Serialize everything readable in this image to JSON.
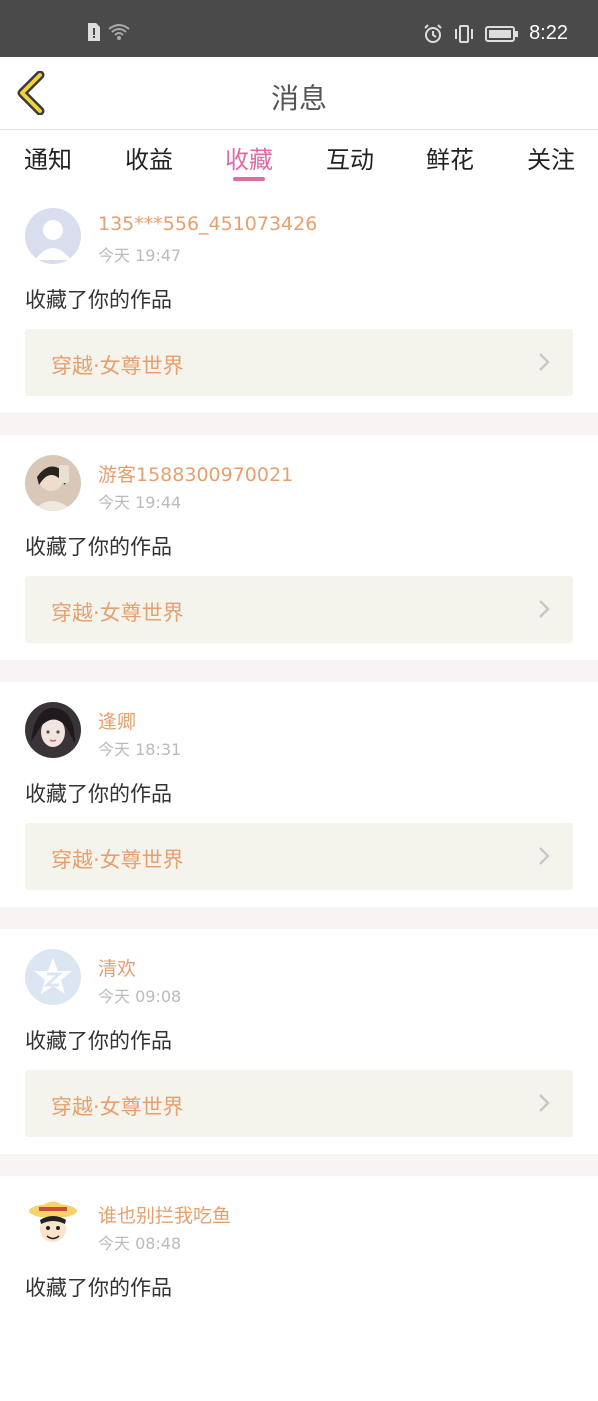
{
  "status_bar": {
    "time": "8:22"
  },
  "header": {
    "title": "消息"
  },
  "tabs": [
    {
      "label": "通知"
    },
    {
      "label": "收益"
    },
    {
      "label": "收藏",
      "active": true
    },
    {
      "label": "互动"
    },
    {
      "label": "鲜花"
    },
    {
      "label": "关注"
    }
  ],
  "messages": [
    {
      "user": "135***556_451073426",
      "time": "今天 19:47",
      "action": "收藏了你的作品",
      "work": "穿越·女尊世界",
      "avatar": "default-avatar-icon"
    },
    {
      "user": "游客1588300970021",
      "time": "今天 19:44",
      "action": "收藏了你的作品",
      "work": "穿越·女尊世界",
      "avatar": "photo-avatar"
    },
    {
      "user": "逢卿",
      "time": "今天 18:31",
      "action": "收藏了你的作品",
      "work": "穿越·女尊世界",
      "avatar": "illustrated-avatar"
    },
    {
      "user": "清欢",
      "time": "今天 09:08",
      "action": "收藏了你的作品",
      "work": "穿越·女尊世界",
      "avatar": "star-z-avatar-icon"
    },
    {
      "user": "谁也别拦我吃鱼",
      "time": "今天 08:48",
      "action": "收藏了你的作品",
      "work": "",
      "avatar": "cartoon-avatar"
    }
  ],
  "colors": {
    "accent": "#e06aa4",
    "name": "#e6a070",
    "card_bg": "#f5f4ec",
    "separator": "#f8f4f4",
    "status_bar": "#4a4a4a"
  }
}
